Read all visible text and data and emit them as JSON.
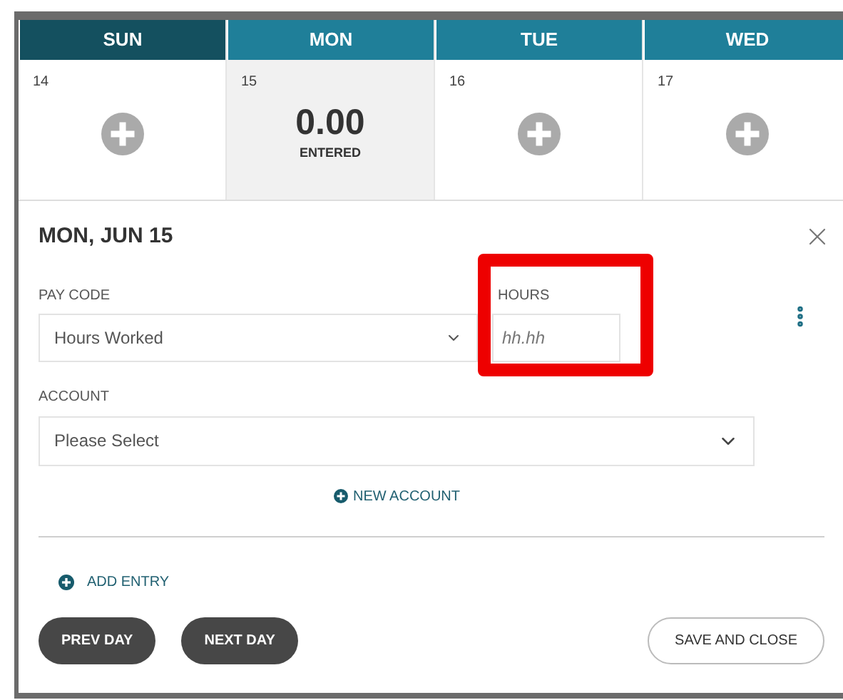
{
  "days": [
    {
      "weekday": "SUN",
      "date": "14",
      "current": true,
      "selected": false
    },
    {
      "weekday": "MON",
      "date": "15",
      "current": false,
      "selected": true,
      "total": "0.00",
      "total_label": "ENTERED"
    },
    {
      "weekday": "TUE",
      "date": "16",
      "current": false,
      "selected": false
    },
    {
      "weekday": "WED",
      "date": "17",
      "current": false,
      "selected": false
    }
  ],
  "panel": {
    "title": "MON, JUN 15",
    "pay_code": {
      "label": "PAY CODE",
      "value": "Hours Worked"
    },
    "hours": {
      "label": "HOURS",
      "placeholder": "hh.hh",
      "highlighted": true
    },
    "account": {
      "label": "ACCOUNT",
      "value": "Please Select"
    },
    "new_account": "NEW ACCOUNT",
    "add_entry": "ADD ENTRY",
    "buttons": [
      {
        "label": "PREV DAY",
        "kind": "dark"
      },
      {
        "label": "NEXT DAY",
        "kind": "dark"
      },
      {
        "label": "SAVE AND CLOSE",
        "kind": "outline"
      }
    ]
  }
}
